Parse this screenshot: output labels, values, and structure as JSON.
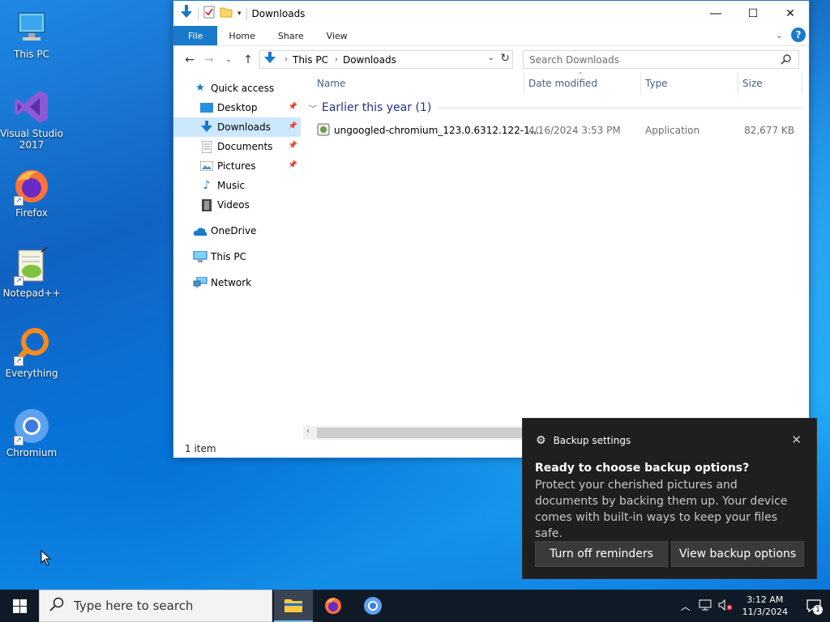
{
  "desktop": {
    "icons": [
      {
        "label": "This PC",
        "icon": "this-pc-icon"
      },
      {
        "label": "Visual Studio 2017",
        "icon": "visual-studio-icon"
      },
      {
        "label": "Firefox",
        "icon": "firefox-icon"
      },
      {
        "label": "Notepad++",
        "icon": "notepadpp-icon"
      },
      {
        "label": "Everything",
        "icon": "everything-icon"
      },
      {
        "label": "Chromium",
        "icon": "chromium-icon"
      }
    ]
  },
  "explorer": {
    "title": "Downloads",
    "ribbon_tabs": [
      "File",
      "Home",
      "Share",
      "View"
    ],
    "address": {
      "crumbs": [
        "This PC",
        "Downloads"
      ]
    },
    "search_placeholder": "Search Downloads",
    "nav": {
      "quick_access": "Quick access",
      "items": [
        {
          "label": "Desktop",
          "pinned": true
        },
        {
          "label": "Downloads",
          "pinned": true,
          "selected": true
        },
        {
          "label": "Documents",
          "pinned": true
        },
        {
          "label": "Pictures",
          "pinned": true
        },
        {
          "label": "Music",
          "pinned": false
        },
        {
          "label": "Videos",
          "pinned": false
        }
      ],
      "onedrive": "OneDrive",
      "this_pc": "This PC",
      "network": "Network"
    },
    "columns": [
      "Name",
      "Date modified",
      "Type",
      "Size"
    ],
    "group": "Earlier this year (1)",
    "files": [
      {
        "name": "ungoogled-chromium_123.0.6312.122-1....",
        "date": "4/16/2024 3:53 PM",
        "type": "Application",
        "size": "82,677 KB"
      }
    ],
    "status": "1 item"
  },
  "toast": {
    "app": "Backup settings",
    "title": "Ready to choose backup options?",
    "body": "Protect your cherished pictures and documents by backing them up. Your device comes with built-in ways to keep your files safe.",
    "buttons": [
      "Turn off reminders",
      "View backup options"
    ]
  },
  "taskbar": {
    "search_placeholder": "Type here to search",
    "time": "3:12 AM",
    "date": "11/3/2024",
    "notification_count": "1"
  },
  "colors": {
    "accent": "#1979ca",
    "selection": "#cce8ff",
    "toast_bg": "#1f1f1f",
    "taskbar_bg": "#101a26"
  }
}
